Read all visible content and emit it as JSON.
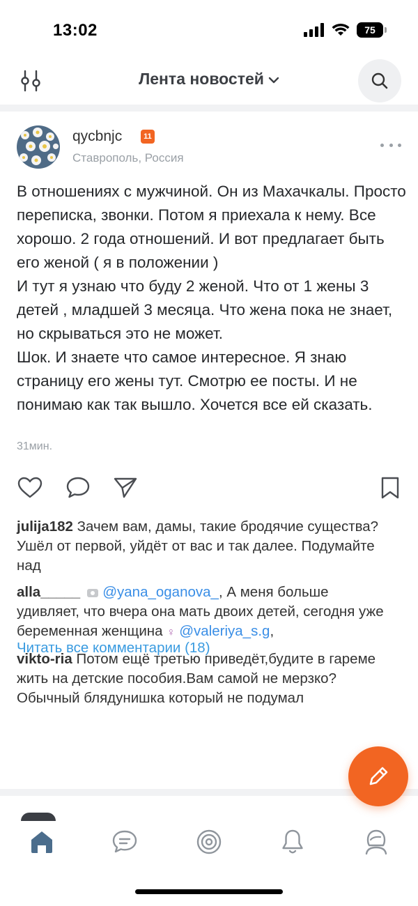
{
  "status_bar": {
    "time": "13:02",
    "battery": "75"
  },
  "header": {
    "title": "Лента новостей"
  },
  "post": {
    "username": "qycbnjc",
    "level": "11",
    "location": "Ставрополь, Россия",
    "text": "В отношениях с мужчиной. Он из Махачкалы. Просто переписка, звонки. Потом я приехала к нему. Все хорошо. 2 года отношений. И вот предлагает быть его женой ( я в положении )\n  И тут я узнаю что буду 2 женой. Что от 1 жены 3 детей , младшей 3 месяца. Что жена пока не знает, но скрываться это не может.\n  Шок. И знаете что самое интересное. Я знаю страницу его жены тут. Смотрю ее посты. И не понимаю как так вышло. Хочется все ей сказать.",
    "time": "31мин."
  },
  "comments": [
    {
      "user": "julija182",
      "text": "Зачем вам, дамы, такие бродячие существа? Ушёл от первой, уйдёт от вас и так далее. Подумайте над"
    },
    {
      "user": "alla_____",
      "mention1": "@yana_oganova_",
      "text": ", А меня больше удивляет, что вчера она мать двоих детей, сегодня уже беременная женщина",
      "mention2": "@valeriya_s.g",
      "after": ","
    },
    {
      "user": "vikto-ria",
      "text": "Потом ещё третью приведёт,будите в гареме жить на детские пособия.Вам самой не мерзко?Обычный блядунишка который не подумал"
    }
  ],
  "read_all": "Читать все комментарии (18)",
  "colors": {
    "accent": "#f26522",
    "link": "#3a9be0",
    "mention": "#3a8ee6",
    "muted": "#9aa0a6"
  },
  "icons": {
    "header": [
      "filter-icon",
      "chevron-down-icon",
      "search-icon"
    ],
    "actions": [
      "heart-icon",
      "comment-icon",
      "share-icon",
      "bookmark-icon"
    ],
    "tabs": [
      "home-icon",
      "messages-icon",
      "discover-icon",
      "notifications-icon",
      "profile-icon"
    ],
    "fab": "pencil-icon"
  }
}
